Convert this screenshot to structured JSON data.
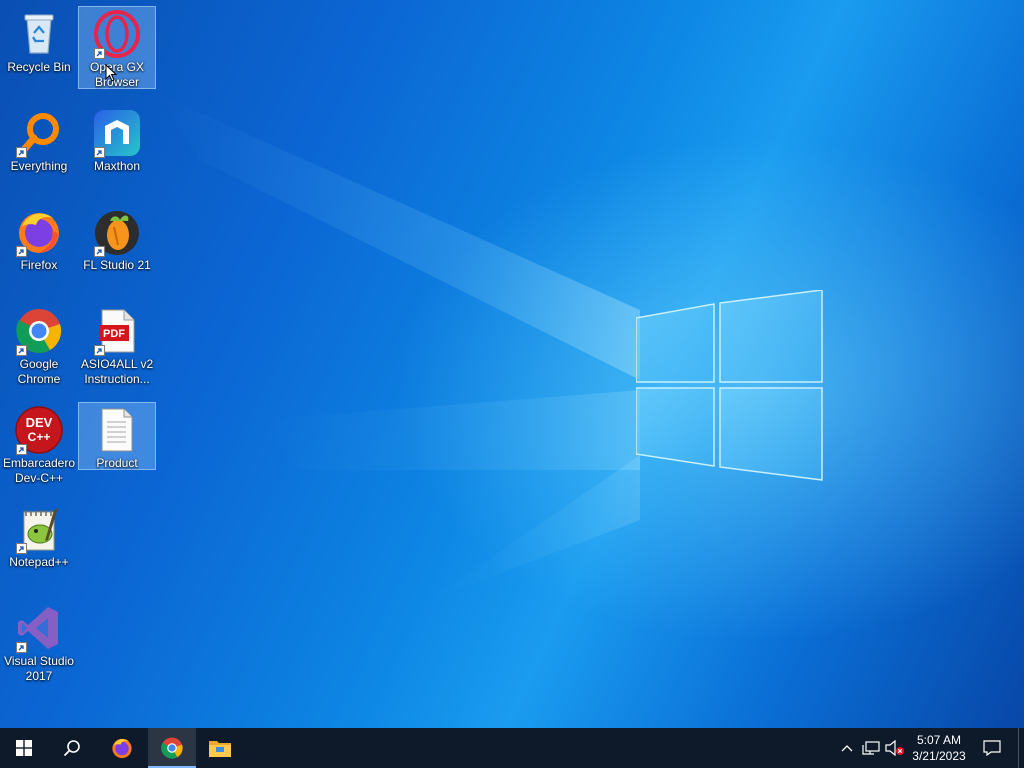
{
  "desktop": {
    "icons": [
      {
        "label": "Recycle Bin",
        "icon": "recycle-bin-icon"
      },
      {
        "label": "Opera GX Browser",
        "icon": "opera-gx-icon"
      },
      {
        "label": "Everything",
        "icon": "everything-search-icon"
      },
      {
        "label": "Maxthon",
        "icon": "maxthon-icon"
      },
      {
        "label": "Firefox",
        "icon": "firefox-icon"
      },
      {
        "label": "FL Studio 21",
        "icon": "fl-studio-icon"
      },
      {
        "label": "Google Chrome",
        "icon": "chrome-icon"
      },
      {
        "label": "ASIO4ALL v2 Instruction...",
        "icon": "pdf-icon",
        "badge": "PDF"
      },
      {
        "label": "Embarcadero Dev-C++",
        "icon": "dev-cpp-icon",
        "badge": "DEV C++"
      },
      {
        "label": "Product",
        "icon": "text-file-icon"
      },
      {
        "label": "Notepad++",
        "icon": "notepad-plus-plus-icon"
      },
      {
        "label": "Visual Studio 2017",
        "icon": "visual-studio-icon"
      }
    ]
  },
  "taskbar": {
    "pinned": [
      "windows-start-icon",
      "search-icon",
      "firefox-icon",
      "chrome-icon",
      "file-explorer-icon"
    ],
    "tray": [
      "chevron-up-icon",
      "network-icon",
      "volume-muted-icon"
    ],
    "time": "5:07 AM",
    "date": "3/21/2023"
  },
  "colors": {
    "taskbar": "#0e1a2a",
    "desktop_blue": "#0b66d3"
  }
}
